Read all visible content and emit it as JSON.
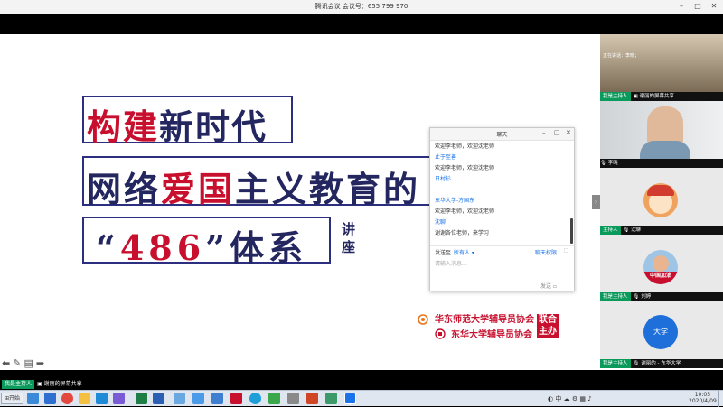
{
  "window": {
    "title": "腾讯会议  会议号：655 799 970",
    "min": "–",
    "max": "□",
    "close": "✕"
  },
  "slide": {
    "line1_red": "构建",
    "line1_navy": "新时代",
    "line2_navy_a": "网络",
    "line2_red": "爱国",
    "line2_navy_b": "主义教育的",
    "line3_quote_open": "“",
    "line3_num": "486",
    "line3_quote_close": "”",
    "line3_navy": "体系",
    "lecture_1": "讲",
    "lecture_2": "座",
    "org1": "华东师范大学辅导员协会",
    "org2": "东华大学辅导员协会",
    "joint": "联合",
    "host": "主办"
  },
  "chat": {
    "title": "聊天",
    "messages": [
      {
        "type": "msg",
        "text": "欢迎李老师，欢迎沈老师"
      },
      {
        "type": "sender",
        "text": "止于至善"
      },
      {
        "type": "msg",
        "text": "欢迎李老师，欢迎沈老师"
      },
      {
        "type": "sender",
        "text": "日村衫"
      },
      {
        "type": "msg",
        "text": ""
      },
      {
        "type": "sender",
        "text": "东华大学-方国东"
      },
      {
        "type": "msg",
        "text": "欢迎李老师，欢迎沈老师"
      },
      {
        "type": "sender",
        "text": "沈聊"
      },
      {
        "type": "msg",
        "text": "谢谢各位老师，来学习"
      }
    ],
    "send_to_label": "发送至",
    "send_to_value": "所有人",
    "permission": "聊天权限",
    "input_placeholder": "请输入消息…",
    "send_button": "发送"
  },
  "participants": {
    "tile1_speaking": "正在讲话：李晓；",
    "tile1_role": "我是主持人",
    "tile1_name": "谢丽的屏幕共享",
    "tile2_name": "李晓",
    "tile3_role": "主持人",
    "tile3_name": "沈聊",
    "tile4_banner": "中国加油",
    "tile4_role": "我是主持人",
    "tile4_name": "刘婷",
    "tile5_avatar": "大学",
    "tile5_role": "我是主持人",
    "tile5_name": "谢丽的 - 东华大学"
  },
  "toolbar": {
    "role": "我是主持人",
    "share": "谢丽的屏幕共享"
  },
  "taskbar": {
    "start": "开始",
    "ime": "中",
    "time": "10:05",
    "date": "2020/4/09"
  },
  "colors": {
    "red": "#c8102e",
    "navy": "#23265f",
    "host_tag": "#0a9b5c",
    "link": "#1a73e8"
  }
}
